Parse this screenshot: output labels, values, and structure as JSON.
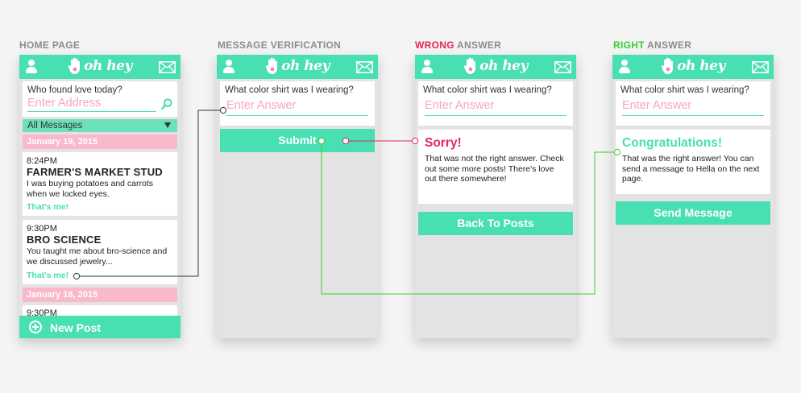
{
  "screens": {
    "home": {
      "title": "HOME PAGE"
    },
    "verification": {
      "title": "MESSAGE VERIFICATION"
    },
    "wrong": {
      "title_highlight": "WRONG",
      "title_rest": " ANSWER"
    },
    "right": {
      "title_highlight": "RIGHT",
      "title_rest": " ANSWER"
    }
  },
  "app": {
    "brand": "oh hey",
    "icons": {
      "user": "user-icon",
      "logo": "hand-icon",
      "mail": "mail-icon",
      "search": "search-icon",
      "add": "plus-circle-icon"
    }
  },
  "colors": {
    "accent": "#48dfb2",
    "pink": "#f9b9ca",
    "wrong": "#e8245a",
    "right": "#3ecb2f",
    "connector_dark": "#333333"
  },
  "home": {
    "search_question": "Who found love today?",
    "search_placeholder": "Enter Address",
    "filter_label": "All Messages",
    "date1": "January 19, 2015",
    "posts": [
      {
        "time": "8:24PM",
        "title": "FARMER'S MARKET STUD",
        "body": "I was buying potatoes and carrots when we locked eyes.",
        "action": "That's me!"
      },
      {
        "time": "9:30PM",
        "title": "BRO SCIENCE",
        "body": "You taught me about bro-science and we discussed jewelry...",
        "action": "That's me!"
      }
    ],
    "date2": "January 18, 2015",
    "partial_time": "9:30PM",
    "new_post_label": "New Post"
  },
  "verification": {
    "question": "What color shirt was I wearing?",
    "placeholder": "Enter Answer",
    "submit_label": "Submit"
  },
  "wrong": {
    "question": "What color shirt was I wearing?",
    "placeholder": "Enter Answer",
    "result_title": "Sorry!",
    "result_body": "That was not the right answer. Check out some more posts! There's love out there somewhere!",
    "button_label": "Back To Posts"
  },
  "right": {
    "question": "What color shirt was I wearing?",
    "placeholder": "Enter Answer",
    "result_title": "Congratulations!",
    "result_body": "That was the right answer! You can send a message to Hella on the next page.",
    "button_label": "Send Message"
  }
}
